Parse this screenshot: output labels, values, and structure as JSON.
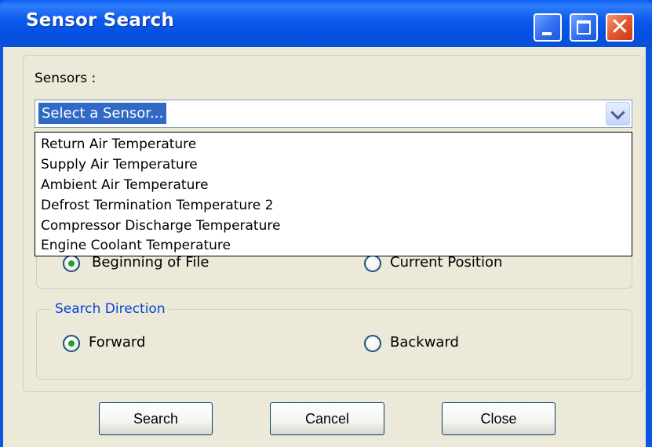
{
  "window": {
    "title": "Sensor Search"
  },
  "sensors": {
    "label": "Sensors :",
    "selected": "Select a Sensor...",
    "options": [
      "Return Air Temperature",
      "Supply Air Temperature",
      "Ambient Air Temperature",
      "Defrost Termination Temperature 2",
      "Compressor Discharge Temperature",
      "Engine Coolant Temperature"
    ]
  },
  "start_from": {
    "options": [
      {
        "label": "Beginning of File",
        "checked": true
      },
      {
        "label": "Current Position",
        "checked": false
      }
    ]
  },
  "search_direction": {
    "legend": "Search Direction",
    "options": [
      {
        "label": "Forward",
        "checked": true
      },
      {
        "label": "Backward",
        "checked": false
      }
    ]
  },
  "buttons": {
    "search": "Search",
    "cancel": "Cancel",
    "close": "Close"
  },
  "icons": {
    "minimize": "minimize-icon",
    "maximize": "maximize-icon",
    "close": "close-icon",
    "dropdown": "chevron-down-icon"
  },
  "colors": {
    "title_bar": "#0551e2",
    "selection": "#316ac5",
    "legend_text": "#0046d5",
    "radio_dot": "#21a121",
    "close_button": "#e3582e",
    "dialog_background": "#ece9d8"
  }
}
